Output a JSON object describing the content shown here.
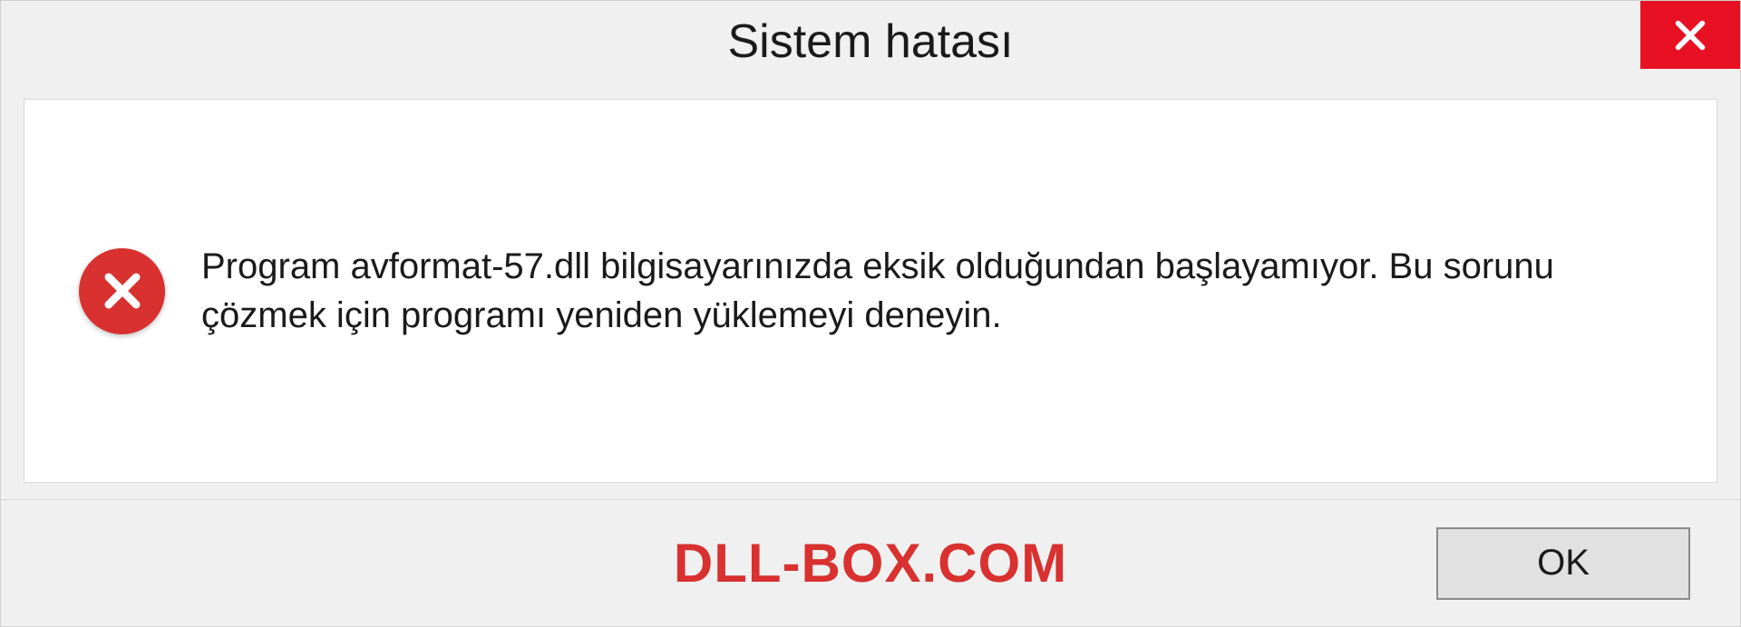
{
  "dialog": {
    "title": "Sistem hatası",
    "message": "Program avformat-57.dll bilgisayarınızda eksik olduğundan başlayamıyor. Bu sorunu çözmek için programı yeniden yüklemeyi deneyin.",
    "ok_label": "OK",
    "watermark": "DLL-BOX.COM"
  },
  "colors": {
    "close_bg": "#e81123",
    "error_icon_bg": "#d8312f",
    "watermark_color": "#d8312f"
  }
}
